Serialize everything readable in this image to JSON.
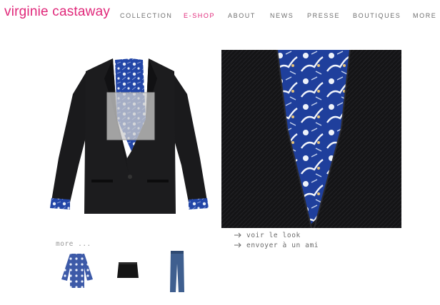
{
  "brand": {
    "name": "virginie castaway",
    "color": "#e0287a"
  },
  "nav": {
    "items": [
      {
        "label": "COLLECTION",
        "active": false
      },
      {
        "label": "E-SHOP",
        "active": true
      },
      {
        "label": "ABOUT",
        "active": false
      },
      {
        "label": "NEWS",
        "active": false
      },
      {
        "label": "PRESSE",
        "active": false
      },
      {
        "label": "BOUTIQUES",
        "active": false
      },
      {
        "label": "MORE",
        "active": false
      }
    ]
  },
  "product": {
    "main_image_icon": "black-blazer-with-floral-lining",
    "zoom_image_icon": "blazer-lapel-closeup"
  },
  "actions": [
    {
      "label": "voir le look",
      "icon": "arrow-right-icon"
    },
    {
      "label": "envoyer à un ami",
      "icon": "arrow-right-icon"
    }
  ],
  "related": {
    "more_label": "more ...",
    "items": [
      {
        "name": "floral-print-blouse"
      },
      {
        "name": "black-mini-skirt"
      },
      {
        "name": "blue-jeans"
      }
    ]
  },
  "colors": {
    "accent": "#e0287a",
    "nav_text": "#6f6f6f",
    "jacket": "#1a1a1c",
    "lining": "#2447a8"
  }
}
